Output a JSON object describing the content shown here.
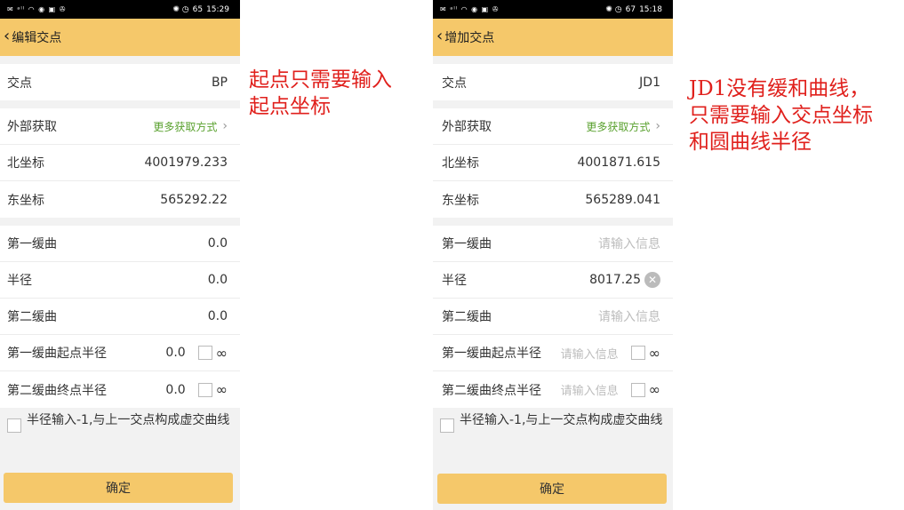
{
  "left": {
    "status": {
      "icons": "✉ ᵃˡˡ ◠ ◉ ▣ ✇",
      "right_icons": "✺ ◷",
      "battery": "65",
      "time": "15:29"
    },
    "title": "编辑交点",
    "rows": {
      "node_label": "交点",
      "node_value": "BP",
      "external_label": "外部获取",
      "external_link": "更多获取方式",
      "north_label": "北坐标",
      "north_value": "4001979.233",
      "east_label": "东坐标",
      "east_value": "565292.22",
      "spiral1_label": "第一缓曲",
      "spiral1_value": "0.0",
      "radius_label": "半径",
      "radius_value": "0.0",
      "spiral2_label": "第二缓曲",
      "spiral2_value": "0.0",
      "s1start_label": "第一缓曲起点半径",
      "s1start_value": "0.0",
      "s2end_label": "第二缓曲终点半径",
      "s2end_value": "0.0",
      "infinity": "∞"
    },
    "virtual_text": "半径输入-1,与上一交点构成虚交曲线",
    "confirm": "确定"
  },
  "right": {
    "status": {
      "icons": "✉ ᵃˡˡ ◠ ◉ ▣ ✇",
      "right_icons": "✺ ◷",
      "battery": "67",
      "time": "15:18"
    },
    "title": "增加交点",
    "rows": {
      "node_label": "交点",
      "node_value": "JD1",
      "external_label": "外部获取",
      "external_link": "更多获取方式",
      "north_label": "北坐标",
      "north_value": "4001871.615",
      "east_label": "东坐标",
      "east_value": "565289.041",
      "spiral1_label": "第一缓曲",
      "spiral1_placeholder": "请输入信息",
      "radius_label": "半径",
      "radius_value": "8017.25",
      "spiral2_label": "第二缓曲",
      "spiral2_placeholder": "请输入信息",
      "s1start_label": "第一缓曲起点半径",
      "s1start_placeholder": "请输入信息",
      "s2end_label": "第二缓曲终点半径",
      "s2end_placeholder": "请输入信息",
      "infinity": "∞"
    },
    "virtual_text": "半径输入-1,与上一交点构成虚交曲线",
    "confirm": "确定"
  },
  "annotations": {
    "left_line1": "起点只需要输入",
    "left_line2": "起点坐标",
    "right_line1": "JD1没有缓和曲线，",
    "right_line2": "只需要输入交点坐标",
    "right_line3": "和圆曲线半径"
  },
  "colors": {
    "accent": "#f5c86a",
    "link": "#5aa12f",
    "annotation": "#e0201c"
  }
}
